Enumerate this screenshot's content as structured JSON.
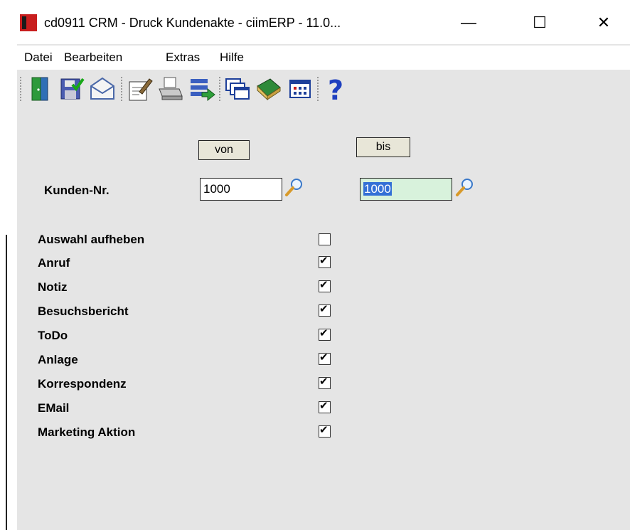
{
  "window": {
    "title": "cd0911 CRM - Druck Kundenakte - ciimERP - 11.0...",
    "minimize": "—",
    "maximize": "☐",
    "close": "✕"
  },
  "menu": [
    "Datei",
    "Bearbeiten",
    "Extras",
    "Hilfe"
  ],
  "toolbar": [
    "exit-door-icon",
    "save-icon",
    "email-icon",
    "edit-document-icon",
    "printer-icon",
    "export-list-icon",
    "windows-icon",
    "book-icon",
    "calendar-icon",
    "help-icon"
  ],
  "range": {
    "from_label": "von",
    "to_label": "bis"
  },
  "customer": {
    "label": "Kunden-Nr.",
    "from_value": "1000",
    "to_value": "1000"
  },
  "options": [
    {
      "label": "Auswahl aufheben",
      "checked": false
    },
    {
      "label": "Anruf",
      "checked": true
    },
    {
      "label": "Notiz",
      "checked": true
    },
    {
      "label": "Besuchsbericht",
      "checked": true
    },
    {
      "label": "ToDo",
      "checked": true
    },
    {
      "label": "Anlage",
      "checked": true
    },
    {
      "label": "Korrespondenz",
      "checked": true
    },
    {
      "label": "EMail",
      "checked": true
    },
    {
      "label": "Marketing Aktion",
      "checked": true
    }
  ],
  "colors": {
    "accent_red": "#c81e1e",
    "selection_blue": "#3370d6",
    "field_green": "#d8f2dc",
    "form_bg": "#e5e5e5"
  }
}
